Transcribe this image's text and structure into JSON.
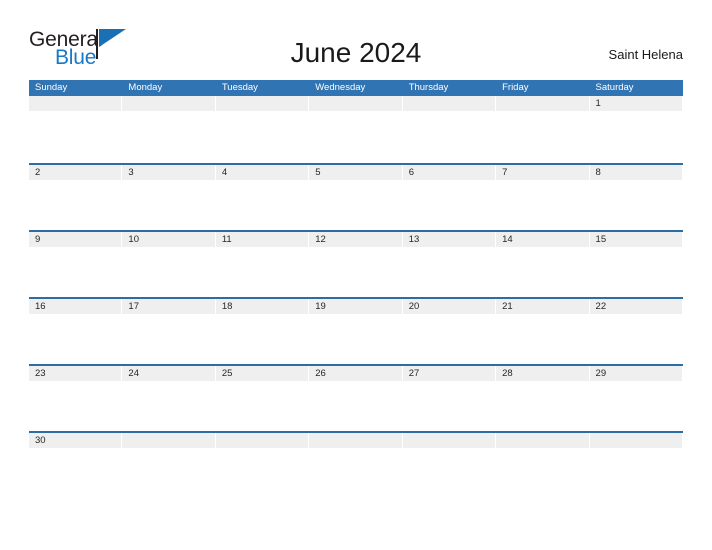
{
  "brand": {
    "name_part1": "General",
    "name_part2": "Blue",
    "triangle_icon": "triangle-icon",
    "color_dark": "#231f20",
    "color_blue": "#1878c8"
  },
  "header": {
    "title": "June 2024",
    "locale": "Saint Helena"
  },
  "calendar": {
    "accent_color": "#3174b4",
    "row_line_color": "#2e6da4",
    "day_band_color": "#efefef",
    "weekdays": [
      "Sunday",
      "Monday",
      "Tuesday",
      "Wednesday",
      "Thursday",
      "Friday",
      "Saturday"
    ],
    "weeks": [
      {
        "days": [
          "",
          "",
          "",
          "",
          "",
          "",
          "1"
        ]
      },
      {
        "days": [
          "2",
          "3",
          "4",
          "5",
          "6",
          "7",
          "8"
        ]
      },
      {
        "days": [
          "9",
          "10",
          "11",
          "12",
          "13",
          "14",
          "15"
        ]
      },
      {
        "days": [
          "16",
          "17",
          "18",
          "19",
          "20",
          "21",
          "22"
        ]
      },
      {
        "days": [
          "23",
          "24",
          "25",
          "26",
          "27",
          "28",
          "29"
        ]
      },
      {
        "days": [
          "30",
          "",
          "",
          "",
          "",
          "",
          ""
        ]
      }
    ]
  }
}
